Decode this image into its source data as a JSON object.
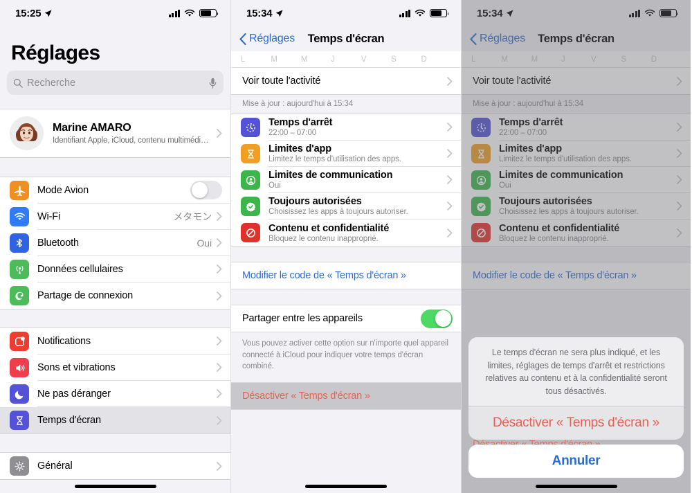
{
  "panels": {
    "left": {
      "status": {
        "time": "15:25"
      },
      "title": "Réglages",
      "search": {
        "placeholder": "Recherche"
      },
      "profile": {
        "name": "Marine AMARO",
        "subtitle": "Identifiant Apple, iCloud, contenu multimédi…"
      },
      "group1": [
        {
          "label": "Mode Avion",
          "icon": "airplane-icon",
          "color": "#f09023",
          "control": "toggle-off"
        },
        {
          "label": "Wi-Fi",
          "icon": "wifi-icon",
          "color": "#2f7cf6",
          "value": "メタモン",
          "control": "chevron"
        },
        {
          "label": "Bluetooth",
          "icon": "bluetooth-icon",
          "color": "#2f63e0",
          "value": "Oui",
          "control": "chevron"
        },
        {
          "label": "Données cellulaires",
          "icon": "cellular-icon",
          "color": "#4cbb5a",
          "value": "",
          "control": "chevron"
        },
        {
          "label": "Partage de connexion",
          "icon": "hotspot-icon",
          "color": "#4cbb5a",
          "value": "",
          "control": "chevron"
        }
      ],
      "group2": [
        {
          "label": "Notifications",
          "icon": "notifications-icon",
          "color": "#f03b2f",
          "value": "",
          "control": "chevron"
        },
        {
          "label": "Sons et vibrations",
          "icon": "sound-icon",
          "color": "#ee3d4b",
          "value": "",
          "control": "chevron"
        },
        {
          "label": "Ne pas déranger",
          "icon": "moon-icon",
          "color": "#5452d6",
          "value": "",
          "control": "chevron"
        },
        {
          "label": "Temps d'écran",
          "icon": "hourglass-icon",
          "color": "#5452d6",
          "value": "",
          "control": "chevron",
          "selected": true
        }
      ],
      "group3": [
        {
          "label": "Général",
          "icon": "gear-icon",
          "color": "#8e8e93",
          "value": "",
          "control": "chevron"
        }
      ]
    },
    "middle": {
      "status": {
        "time": "15:34"
      },
      "nav": {
        "back": "Réglages",
        "title": "Temps d'écran"
      },
      "weekdays": [
        "L",
        "M",
        "M",
        "J",
        "V",
        "S",
        "D"
      ],
      "activity_row": {
        "label": "Voir toute l'activité"
      },
      "update_note": "Mise à jour : aujourd'hui à 15:34",
      "features": [
        {
          "label": "Temps d'arrêt",
          "sub": "22:00 – 07:00",
          "icon": "downtime-icon",
          "color": "#5452d6"
        },
        {
          "label": "Limites d'app",
          "sub": "Limitez le temps d'utilisation des apps.",
          "icon": "app-limits-icon",
          "color": "#f09f23"
        },
        {
          "label": "Limites de communication",
          "sub": "Oui",
          "icon": "communication-icon",
          "color": "#3cb54a"
        },
        {
          "label": "Toujours autorisées",
          "sub": "Choisissez les apps à toujours autoriser.",
          "icon": "always-allowed-icon",
          "color": "#3cb54a"
        },
        {
          "label": "Contenu et confidentialité",
          "sub": "Bloquez le contenu inapproprié.",
          "icon": "content-privacy-icon",
          "color": "#e0322c"
        }
      ],
      "passcode_link": "Modifier le code de « Temps d'écran »",
      "share_row": {
        "label": "Partager entre les appareils",
        "toggle": "on"
      },
      "share_note": "Vous pouvez activer cette option sur n'importe quel appareil connecté à iCloud pour indiquer votre temps d'écran combiné.",
      "disable_row": "Désactiver « Temps d'écran »"
    },
    "right": {
      "status": {
        "time": "15:34"
      },
      "nav": {
        "back": "Réglages",
        "title": "Temps d'écran"
      },
      "weekdays": [
        "L",
        "M",
        "M",
        "J",
        "V",
        "S",
        "D"
      ],
      "activity_row": {
        "label": "Voir toute l'activité"
      },
      "update_note": "Mise à jour : aujourd'hui à 15:34",
      "features": [
        {
          "label": "Temps d'arrêt",
          "sub": "22:00 – 07:00",
          "icon": "downtime-icon",
          "color": "#5452d6"
        },
        {
          "label": "Limites d'app",
          "sub": "Limitez le temps d'utilisation des apps.",
          "icon": "app-limits-icon",
          "color": "#f09f23"
        },
        {
          "label": "Limites de communication",
          "sub": "Oui",
          "icon": "communication-icon",
          "color": "#3cb54a"
        },
        {
          "label": "Toujours autorisées",
          "sub": "Choisissez les apps à toujours autoriser.",
          "icon": "always-allowed-icon",
          "color": "#3cb54a"
        },
        {
          "label": "Contenu et confidentialité",
          "sub": "Bloquez le contenu inapproprié.",
          "icon": "content-privacy-icon",
          "color": "#e0322c"
        }
      ],
      "passcode_link": "Modifier le code de « Temps d'écran »",
      "behind_disable_row": "Désactiver « Temps d'écran »",
      "action_sheet": {
        "message": "Le temps d'écran ne sera plus indiqué, et les limites, réglages de temps d'arrêt et restrictions relatives au contenu et à la confidentialité seront tous désactivés.",
        "destructive": "Désactiver « Temps d'écran »",
        "cancel": "Annuler"
      }
    }
  },
  "colors": {
    "accent_blue": "#2b6cd4",
    "destructive_red": "#e8604f",
    "toggle_green": "#4cd964",
    "background": "#f2f2f7"
  }
}
